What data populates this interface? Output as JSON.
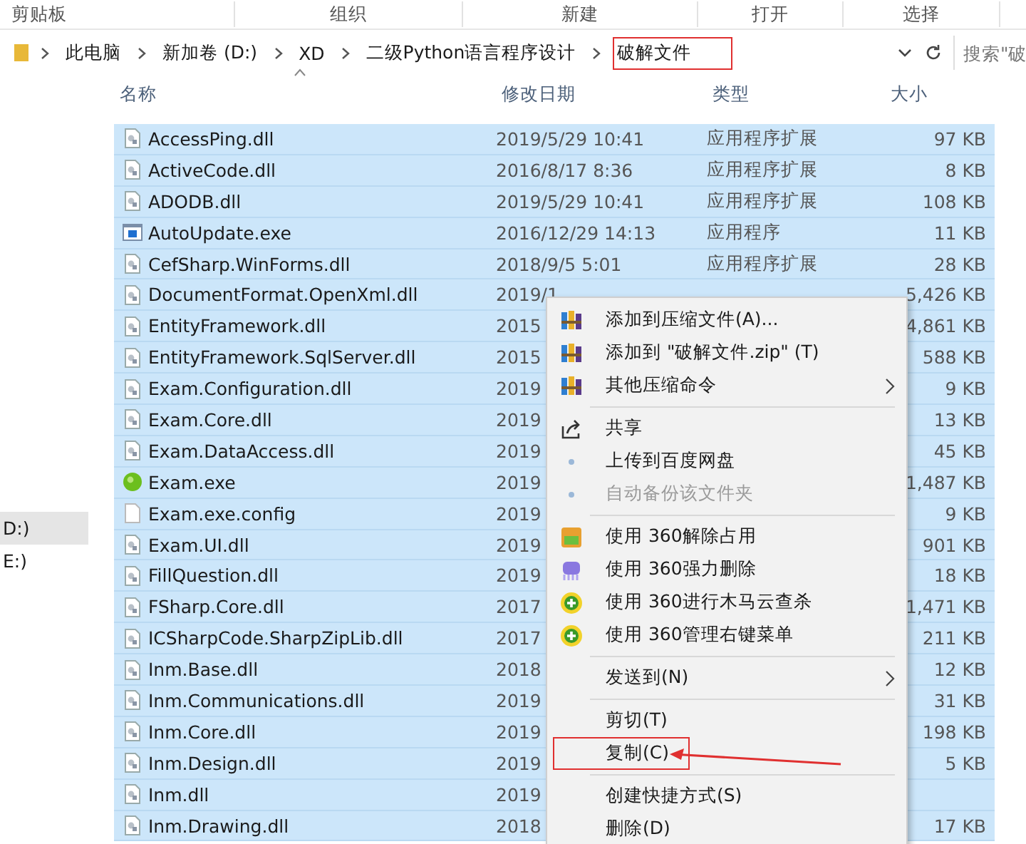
{
  "ribbon": {
    "groups": [
      "剪贴板",
      "组织",
      "新建",
      "打开",
      "选择"
    ]
  },
  "address_bar": {
    "crumbs": [
      {
        "label": "此电脑",
        "highlighted": false
      },
      {
        "label": "新加卷 (D:)",
        "highlighted": false
      },
      {
        "label": "XD",
        "highlighted": false
      },
      {
        "label": "二级Python语言程序设计",
        "highlighted": false
      },
      {
        "label": "破解文件",
        "highlighted": true
      }
    ],
    "search": {
      "placeholder": "搜索\"破"
    }
  },
  "nav": [
    {
      "label": "D:)",
      "selected": true
    },
    {
      "label": "E:)",
      "selected": false
    }
  ],
  "columns": [
    {
      "label": "名称",
      "sorted": true
    },
    {
      "label": "修改日期",
      "sorted": false
    },
    {
      "label": "类型",
      "sorted": false
    },
    {
      "label": "大小",
      "sorted": false
    }
  ],
  "rows": [
    {
      "name": "AccessPing.dll",
      "kind": "dll",
      "date": "2019/5/29 10:41",
      "type": "应用程序扩展",
      "size": "97 KB",
      "selected": true
    },
    {
      "name": "ActiveCode.dll",
      "kind": "dll",
      "date": "2016/8/17 8:36",
      "type": "应用程序扩展",
      "size": "8 KB",
      "selected": true
    },
    {
      "name": "ADODB.dll",
      "kind": "dll",
      "date": "2019/5/29 10:41",
      "type": "应用程序扩展",
      "size": "108 KB",
      "selected": true
    },
    {
      "name": "AutoUpdate.exe",
      "kind": "app",
      "date": "2016/12/29 14:13",
      "type": "应用程序",
      "size": "11 KB",
      "selected": true
    },
    {
      "name": "CefSharp.WinForms.dll",
      "kind": "dll",
      "date": "2018/9/5 5:01",
      "type": "应用程序扩展",
      "size": "28 KB",
      "selected": true
    },
    {
      "name": "DocumentFormat.OpenXml.dll",
      "kind": "dll",
      "date": "2019/1",
      "size": "5,426 KB",
      "selected": true
    },
    {
      "name": "EntityFramework.dll",
      "kind": "dll",
      "date": "2015",
      "size": "4,861 KB",
      "selected": true
    },
    {
      "name": "EntityFramework.SqlServer.dll",
      "kind": "dll",
      "date": "2015",
      "size": "588 KB",
      "selected": true
    },
    {
      "name": "Exam.Configuration.dll",
      "kind": "dll",
      "date": "2019",
      "size": "9 KB",
      "selected": true
    },
    {
      "name": "Exam.Core.dll",
      "kind": "dll",
      "date": "2019",
      "size": "13 KB",
      "selected": true
    },
    {
      "name": "Exam.DataAccess.dll",
      "kind": "dll",
      "date": "2019",
      "size": "45 KB",
      "selected": true
    },
    {
      "name": "Exam.exe",
      "kind": "orb",
      "date": "2019",
      "size": "1,487 KB",
      "selected": true
    },
    {
      "name": "Exam.exe.config",
      "kind": "blank",
      "date": "2019",
      "size": "9 KB",
      "selected": true
    },
    {
      "name": "Exam.UI.dll",
      "kind": "dll",
      "date": "2019",
      "size": "901 KB",
      "selected": true
    },
    {
      "name": "FillQuestion.dll",
      "kind": "dll",
      "date": "2019",
      "size": "18 KB",
      "selected": true
    },
    {
      "name": "FSharp.Core.dll",
      "kind": "dll",
      "date": "2017",
      "size": "1,471 KB",
      "selected": true
    },
    {
      "name": "ICSharpCode.SharpZipLib.dll",
      "kind": "dll",
      "date": "2017",
      "size": "211 KB",
      "selected": true
    },
    {
      "name": "Inm.Base.dll",
      "kind": "dll",
      "date": "2018",
      "size": "12 KB",
      "selected": true
    },
    {
      "name": "Inm.Communications.dll",
      "kind": "dll",
      "date": "2019",
      "size": "31 KB",
      "selected": true
    },
    {
      "name": "Inm.Core.dll",
      "kind": "dll",
      "date": "2019",
      "size": "198 KB",
      "selected": true
    },
    {
      "name": "Inm.Design.dll",
      "kind": "dll",
      "date": "2019",
      "size": "5 KB",
      "selected": true
    },
    {
      "name": "Inm.dll",
      "kind": "dll",
      "date": "2019",
      "selected": true
    },
    {
      "name": "Inm.Drawing.dll",
      "kind": "dll",
      "date": "2018",
      "size": "17 KB",
      "selected": true
    }
  ],
  "context_menu": [
    {
      "kind": "archive",
      "label": "添加到压缩文件(A)...",
      "submenu": false,
      "disabled": false,
      "highlighted": false
    },
    {
      "kind": "archive",
      "label": "添加到 \"破解文件.zip\" (T)",
      "submenu": false,
      "disabled": false,
      "highlighted": false
    },
    {
      "kind": "archive",
      "label": "其他压缩命令",
      "submenu": true,
      "disabled": false,
      "highlighted": false
    },
    {
      "kind": "separator"
    },
    {
      "kind": "share",
      "label": "共享",
      "submenu": false,
      "disabled": false,
      "highlighted": false
    },
    {
      "kind": "cloud",
      "label": "上传到百度网盘",
      "submenu": false,
      "disabled": false,
      "highlighted": false
    },
    {
      "kind": "cloud",
      "label": "自动备份该文件夹",
      "submenu": false,
      "disabled": true,
      "highlighted": false
    },
    {
      "kind": "separator"
    },
    {
      "kind": "unlock",
      "label": "使用 360解除占用",
      "submenu": false,
      "disabled": false,
      "highlighted": false
    },
    {
      "kind": "shred",
      "label": "使用 360强力删除",
      "submenu": false,
      "disabled": false,
      "highlighted": false
    },
    {
      "kind": "scan",
      "label": "使用 360进行木马云查杀",
      "submenu": false,
      "disabled": false,
      "highlighted": false
    },
    {
      "kind": "scan",
      "label": "使用 360管理右键菜单",
      "submenu": false,
      "disabled": false,
      "highlighted": false
    },
    {
      "kind": "separator"
    },
    {
      "kind": "plain",
      "label": "发送到(N)",
      "submenu": true,
      "disabled": false,
      "highlighted": false
    },
    {
      "kind": "separator"
    },
    {
      "kind": "plain",
      "label": "剪切(T)",
      "submenu": false,
      "disabled": false,
      "highlighted": false
    },
    {
      "kind": "plain",
      "label": "复制(C)",
      "submenu": false,
      "disabled": false,
      "highlighted": true
    },
    {
      "kind": "separator"
    },
    {
      "kind": "plain",
      "label": "创建快捷方式(S)",
      "submenu": false,
      "disabled": false,
      "highlighted": false
    },
    {
      "kind": "plain",
      "label": "删除(D)",
      "submenu": false,
      "disabled": false,
      "highlighted": false
    }
  ]
}
